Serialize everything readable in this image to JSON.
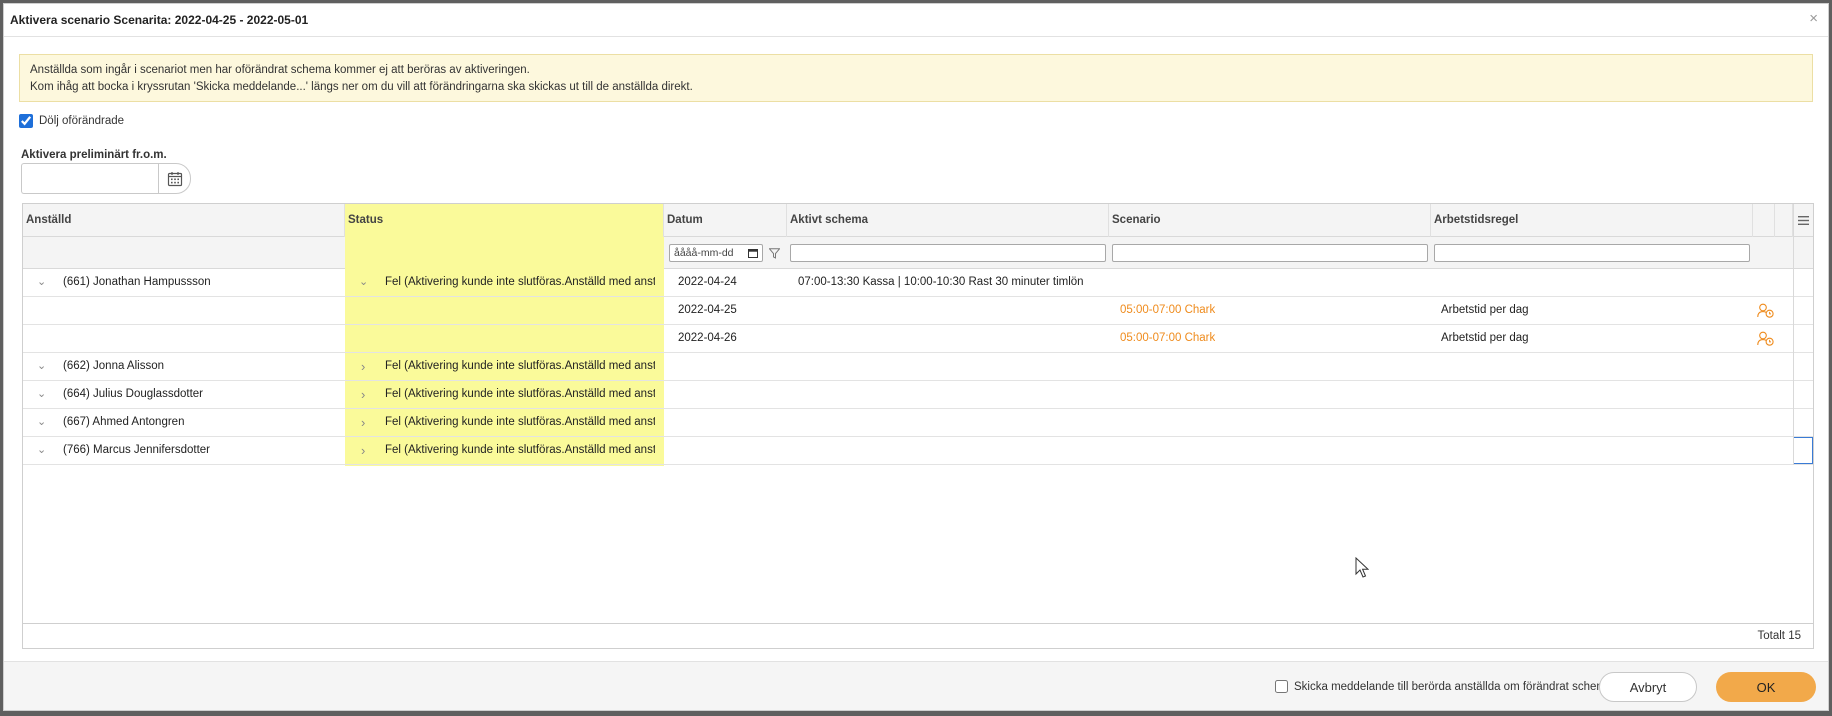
{
  "dialog": {
    "title": "Aktivera scenario Scenarita: 2022-04-25 - 2022-05-01",
    "close_symbol": "×"
  },
  "notice": {
    "line1": "Anställda som ingår i scenariot men har oförändrat schema kommer ej att beröras av aktiveringen.",
    "line2": "Kom ihåg att bocka i kryssrutan 'Skicka meddelande...' längs ner om du vill att förändringarna ska skickas ut till de anställda direkt."
  },
  "hide_unchanged": {
    "label": "Dölj oförändrade",
    "checked": true
  },
  "prelim": {
    "label": "Aktivera preliminärt fr.o.m.",
    "value": ""
  },
  "columns": {
    "employee": "Anställd",
    "status": "Status",
    "date": "Datum",
    "active_schedule": "Aktivt schema",
    "scenario": "Scenario",
    "work_rule": "Arbetstidsregel"
  },
  "filters": {
    "date_placeholder": "åååå-mm-dd"
  },
  "rows": [
    {
      "employee": "(661) Jonathan Hampussson",
      "status": "Fel (Aktivering kunde inte slutföras.Anställd med anstä...",
      "date": "2022-04-24",
      "active_schedule": "07:00-13:30 Kassa | 10:00-10:30 Rast 30 minuter timlön",
      "scenario": "",
      "rule": ""
    },
    {
      "employee": "",
      "status": "",
      "date": "2022-04-25",
      "active_schedule": "",
      "scenario": "05:00-07:00 Chark",
      "rule": "Arbetstid per dag"
    },
    {
      "employee": "",
      "status": "",
      "date": "2022-04-26",
      "active_schedule": "",
      "scenario": "05:00-07:00 Chark",
      "rule": "Arbetstid per dag"
    },
    {
      "employee": "(662) Jonna Alisson",
      "status": "Fel (Aktivering kunde inte slutföras.Anställd med anstä...",
      "date": "",
      "active_schedule": "",
      "scenario": "",
      "rule": ""
    },
    {
      "employee": "(664) Julius Douglassdotter",
      "status": "Fel (Aktivering kunde inte slutföras.Anställd med anstä...",
      "date": "",
      "active_schedule": "",
      "scenario": "",
      "rule": ""
    },
    {
      "employee": "(667) Ahmed Antongren",
      "status": "Fel (Aktivering kunde inte slutföras.Anställd med anstä...",
      "date": "",
      "active_schedule": "",
      "scenario": "",
      "rule": ""
    },
    {
      "employee": "(766) Marcus Jennifersdotter",
      "status": "Fel (Aktivering kunde inte slutföras.Anställd med anstä...",
      "date": "",
      "active_schedule": "",
      "scenario": "",
      "rule": ""
    }
  ],
  "grid_footer": {
    "total": "Totalt 15"
  },
  "footer": {
    "notify_label": "Skicka meddelande till berörda anställda om förändrat schema",
    "cancel": "Avbryt",
    "ok": "OK"
  },
  "colors": {
    "status_highlight": "#fafa9a",
    "accent": "#f2a94a",
    "scenario_text": "#ef8b1c"
  }
}
